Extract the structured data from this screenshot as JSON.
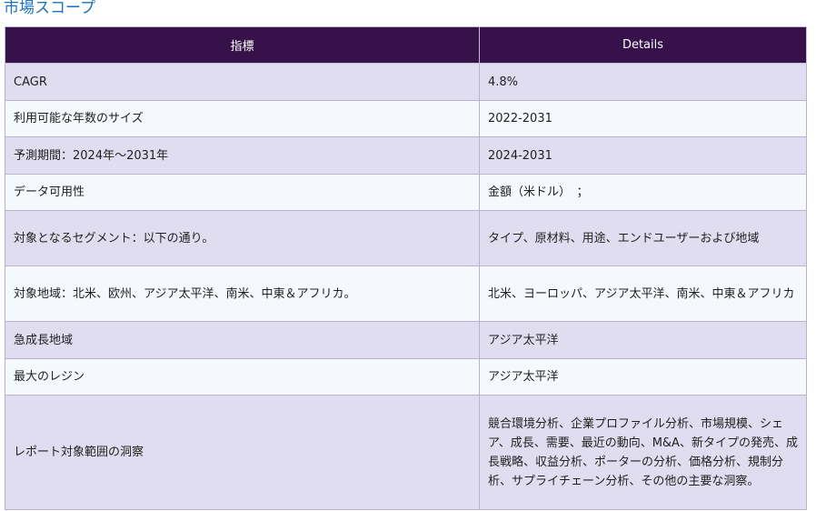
{
  "title": "市場スコープ",
  "table": {
    "headers": [
      "指標",
      "Details"
    ],
    "rows": [
      {
        "metric": "CAGR",
        "details": "4.8%"
      },
      {
        "metric": "利用可能な年数のサイズ",
        "details": "2022-2031"
      },
      {
        "metric": "予測期間：2024年～2031年",
        "details": "2024-2031"
      },
      {
        "metric": "データ可用性",
        "details": "金額（米ドル）　；"
      },
      {
        "metric": "対象となるセグメント：以下の通り。",
        "details": "タイプ、原材料、用途、エンドユーザーおよび地域"
      },
      {
        "metric": "対象地域：北米、欧州、アジア太平洋、南米、中東＆アフリカ。",
        "details": "北米、ヨーロッパ、アジア太平洋、南米、中東＆アフリカ"
      },
      {
        "metric": "急成長地域",
        "details": "アジア太平洋"
      },
      {
        "metric": "最大のレジン",
        "details": "アジア太平洋"
      },
      {
        "metric": "レポート対象範囲の洞察",
        "details": "競合環境分析、企業プロファイル分析、市場規模、シェア、成長、需要、最近の動向、M&A、新タイプの発売、成長戦略、収益分析、ポーターの分析、価格分析、規制分析、サプライチェーン分析、その他の主要な洞察。"
      }
    ]
  }
}
